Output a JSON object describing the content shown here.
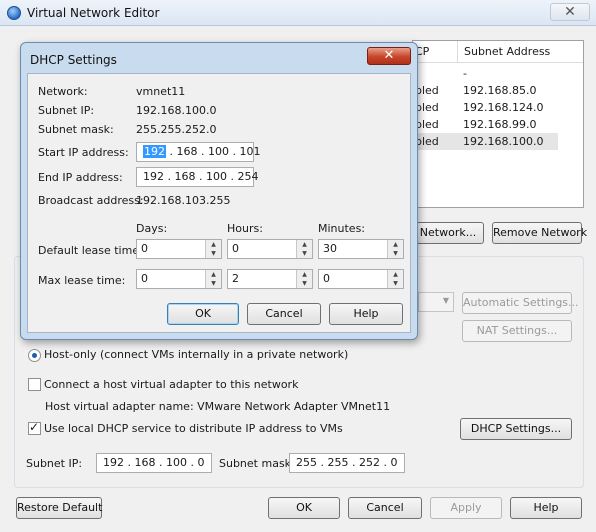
{
  "parent": {
    "title": "Virtual Network Editor",
    "close_glyph": "✕",
    "table": {
      "columns": [
        "CP",
        "Subnet Address"
      ],
      "rows": [
        {
          "status": "",
          "subnet": "-"
        },
        {
          "status": "bled",
          "subnet": "192.168.85.0"
        },
        {
          "status": "bled",
          "subnet": "192.168.124.0"
        },
        {
          "status": "bled",
          "subnet": "192.168.99.0"
        },
        {
          "status": "bled",
          "subnet": "192.168.100.0"
        }
      ]
    },
    "add_network_label": "Network...",
    "remove_network_label": "Remove Network",
    "automatic_settings_label": "Automatic Settings...",
    "nat_settings_label": "NAT Settings...",
    "host_only_label": "Host-only (connect VMs internally in a private network)",
    "connect_adapter_label": "Connect a host virtual adapter to this network",
    "adapter_name_label": "Host virtual adapter name: VMware Network Adapter VMnet11",
    "use_dhcp_label": "Use local DHCP service to distribute IP address to VMs",
    "dhcp_settings_label": "DHCP Settings...",
    "subnet_ip_label": "Subnet IP:",
    "subnet_ip_value": "192 . 168 . 100 .  0",
    "subnet_mask_label": "Subnet mask:",
    "subnet_mask_value": "255 . 255 . 252 .  0",
    "restore_default_label": "Restore Default",
    "ok_label": "OK",
    "cancel_label": "Cancel",
    "apply_label": "Apply",
    "help_label": "Help"
  },
  "dhcp": {
    "title": "DHCP Settings",
    "close_glyph": "✕",
    "network_label": "Network:",
    "network_value": "vmnet11",
    "subnet_ip_label": "Subnet IP:",
    "subnet_ip_value": "192.168.100.0",
    "subnet_mask_label": "Subnet mask:",
    "subnet_mask_value": "255.255.252.0",
    "start_ip_label": "Start IP address:",
    "start_ip_first": "192",
    "start_ip_rest": " . 168 . 100 . 101",
    "end_ip_label": "End IP address:",
    "end_ip_value": "192 . 168 . 100 . 254",
    "broadcast_label": "Broadcast address:",
    "broadcast_value": "192.168.103.255",
    "days_label": "Days:",
    "hours_label": "Hours:",
    "minutes_label": "Minutes:",
    "default_lease_label": "Default lease time:",
    "default_days": "0",
    "default_hours": "0",
    "default_minutes": "30",
    "max_lease_label": "Max lease time:",
    "max_days": "0",
    "max_hours": "2",
    "max_minutes": "0",
    "ok_label": "OK",
    "cancel_label": "Cancel",
    "help_label": "Help"
  },
  "colors": {
    "accent": "#3399ff",
    "close_red": "#c7452a"
  },
  "icons": {
    "app": "globe-network-icon",
    "spin_up": "▲",
    "spin_down": "▼",
    "check": "✓"
  }
}
